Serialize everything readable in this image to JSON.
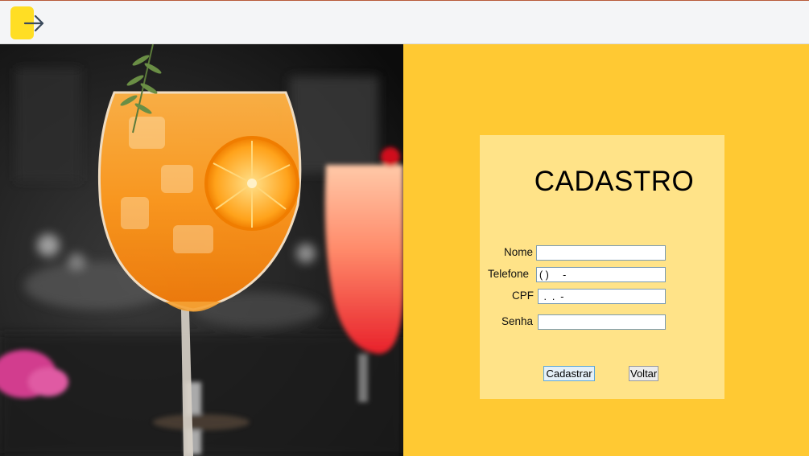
{
  "window": {
    "back_icon": "arrow-right-icon",
    "accent": "#ffde24"
  },
  "photo": {
    "subject": "orange-cocktail-photo"
  },
  "form": {
    "title": "CADASTRO",
    "background": "#ffe388",
    "panel_background": "#ffc933",
    "fields": {
      "nome": {
        "label": "Nome",
        "value": ""
      },
      "telefone": {
        "label": "Telefone",
        "value": "( )     -"
      },
      "cpf": {
        "label": "CPF",
        "value": " .  .  -"
      },
      "senha": {
        "label": "Senha",
        "value": ""
      }
    },
    "buttons": {
      "cadastrar": "Cadastrar",
      "voltar": "Voltar"
    }
  }
}
